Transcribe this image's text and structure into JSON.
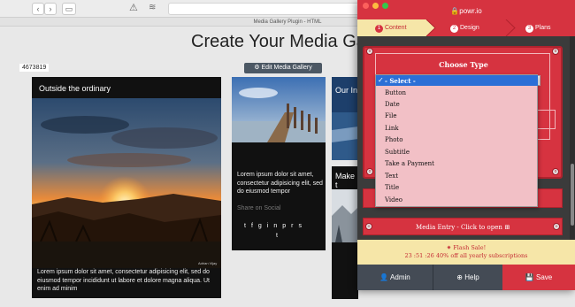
{
  "browser": {
    "tab_title": "Media Gallery Plugin - HTML"
  },
  "page": {
    "title": "Create Your Media Galle",
    "gallery_id": "4673819",
    "edit_button": "Edit Media Gallery",
    "cards": [
      {
        "caption": "Outside the ordinary",
        "description": "Lorem ipsum dolor sit amet, consectetur adipisicing elit, sed do eiusmod tempor incididunt ut labore et dolore magna aliqua. Ut enim ad minim",
        "watermark": "Adrian Vijay"
      },
      {
        "description": "Lorem ipsum dolor sit amet, consectetur adipisicing elit, sed do eiusmod tempor",
        "share_label": "Share on Social"
      },
      {
        "caption": "Our In"
      },
      {
        "caption": "Make t"
      }
    ]
  },
  "popup": {
    "title": "powr.io",
    "steps": [
      {
        "num": "1",
        "label": "Content"
      },
      {
        "num": "2",
        "label": "Design"
      },
      {
        "num": "3",
        "label": "Plans"
      }
    ],
    "choose_type_label": "Choose Type",
    "dropdown_options": [
      "- Select -",
      "Button",
      "Date",
      "File",
      "Link",
      "Photo",
      "Subtitle",
      "Take a Payment",
      "Text",
      "Title",
      "Video"
    ],
    "media_entry_label": "Media Entry - Click to open",
    "flash_line1": "Flash Sale!",
    "flash_line2": "23 :51 :26  40% off all yearly subscriptions",
    "footer": {
      "admin": "Admin",
      "help": "Help",
      "save": "Save"
    },
    "colors": {
      "brand_red": "#d63340",
      "footer_dark": "#444b55",
      "flash_bg": "#f6e6a8"
    }
  }
}
